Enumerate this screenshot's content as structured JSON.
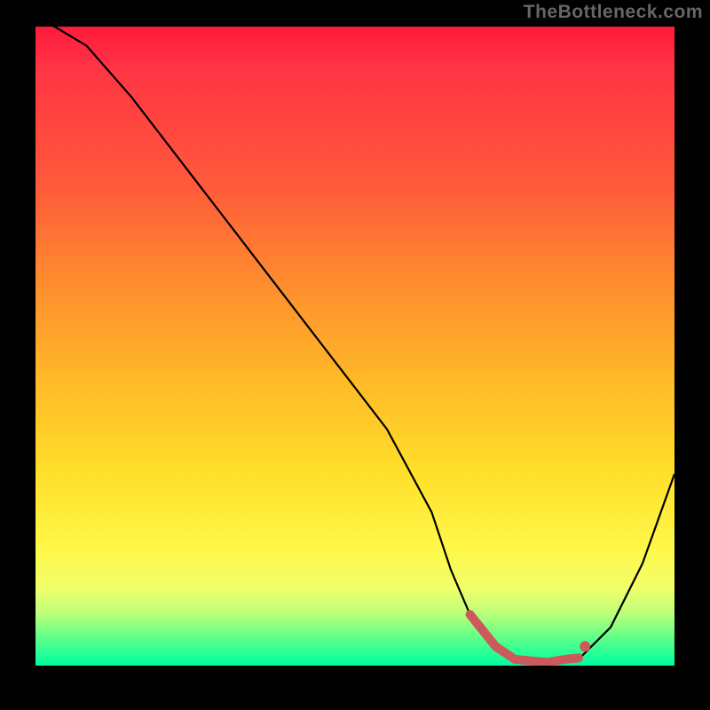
{
  "watermark": "TheBottleneck.com",
  "chart_data": {
    "type": "line",
    "title": "",
    "xlabel": "",
    "ylabel": "",
    "xlim": [
      0,
      100
    ],
    "ylim": [
      0,
      100
    ],
    "series": [
      {
        "name": "bottleneck-curve",
        "x": [
          0,
          3,
          8,
          15,
          25,
          35,
          45,
          55,
          62,
          65,
          68,
          72,
          75,
          80,
          85,
          90,
          95,
          100
        ],
        "y": [
          101,
          100,
          97,
          89,
          76,
          63,
          50,
          37,
          24,
          15,
          8,
          3,
          1,
          0.5,
          1,
          6,
          16,
          30
        ]
      }
    ],
    "highlight": {
      "name": "optimal-range",
      "x": [
        68,
        72,
        75,
        78,
        80,
        83,
        85
      ],
      "y": [
        8,
        3,
        1,
        0.7,
        0.5,
        1,
        1.2
      ],
      "dot": {
        "x": 86,
        "y": 3
      }
    },
    "description": "Curve descends from top-left to a minimum near x≈78 then rises toward the right edge. The near-zero valley is highlighted in salmon."
  }
}
